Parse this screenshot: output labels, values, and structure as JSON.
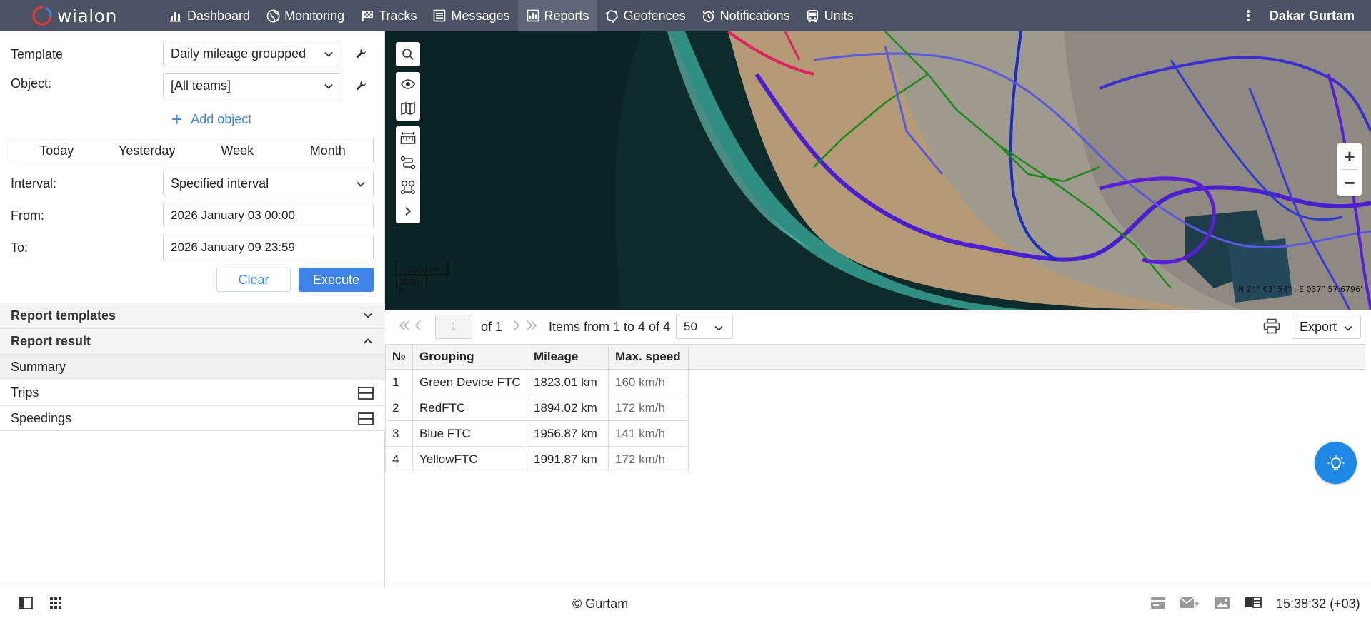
{
  "app": {
    "logo_text": "wialon",
    "user": "Dakar Gurtam"
  },
  "nav": [
    {
      "label": "Dashboard",
      "icon": "chart-bars-icon"
    },
    {
      "label": "Monitoring",
      "icon": "globe-icon"
    },
    {
      "label": "Tracks",
      "icon": "checkered-flag-icon"
    },
    {
      "label": "Messages",
      "icon": "list-icon"
    },
    {
      "label": "Reports",
      "icon": "report-icon",
      "active": true
    },
    {
      "label": "Geofences",
      "icon": "geofence-icon"
    },
    {
      "label": "Notifications",
      "icon": "alarm-clock-icon"
    },
    {
      "label": "Units",
      "icon": "bus-icon"
    }
  ],
  "form": {
    "template_label": "Template",
    "template_value": "Daily mileage groupped",
    "object_label": "Object:",
    "object_value": "[All teams]",
    "add_object": "Add object",
    "periods": [
      "Today",
      "Yesterday",
      "Week",
      "Month"
    ],
    "interval_label": "Interval:",
    "interval_value": "Specified interval",
    "from_label": "From:",
    "from_value": "2026 January 03 00:00",
    "to_label": "To:",
    "to_value": "2026 January 09 23:59",
    "clear": "Clear",
    "execute": "Execute"
  },
  "accordion": {
    "report_templates": "Report templates",
    "report_result": "Report result",
    "items": [
      "Summary",
      "Trips",
      "Speedings"
    ]
  },
  "map": {
    "scale_m": "1000 m",
    "scale_ft": "2000 ft",
    "coords": "N 24° 03' 54\" : E 037° 57.6796'"
  },
  "pagination": {
    "page": "1",
    "of": "of 1",
    "items": "Items from 1 to 4 of 4",
    "per_page": "50",
    "export": "Export"
  },
  "table": {
    "headers": [
      "№",
      "Grouping",
      "Mileage",
      "Max. speed"
    ],
    "rows": [
      [
        "1",
        "Green Device FTC",
        "1823.01 km",
        "160 km/h"
      ],
      [
        "2",
        "RedFTC",
        "1894.02 km",
        "172 km/h"
      ],
      [
        "3",
        "Blue FTC",
        "1956.87 km",
        "141 km/h"
      ],
      [
        "4",
        "YellowFTC",
        "1991.87 km",
        "172 km/h"
      ]
    ]
  },
  "footer": {
    "copyright": "© Gurtam",
    "time": "15:38:32 (+03)"
  },
  "colors": {
    "accent": "#3d84e6",
    "topbar": "#4b5263",
    "fab": "#1e88e5"
  }
}
